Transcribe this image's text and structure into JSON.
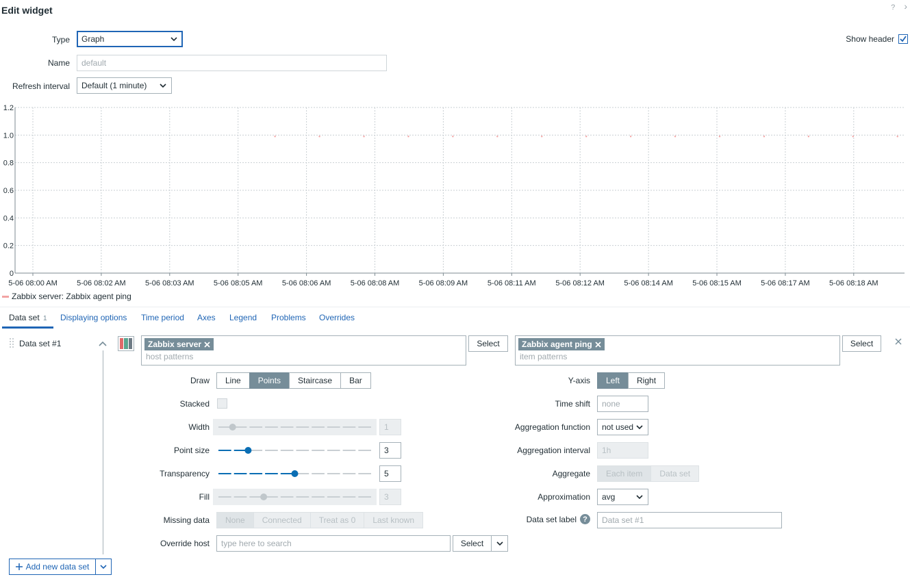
{
  "header": {
    "title": "Edit widget",
    "help_icon": "?",
    "collapse_icon": "›"
  },
  "form": {
    "type_label": "Type",
    "type_value": "Graph",
    "name_label": "Name",
    "name_placeholder": "default",
    "refresh_label": "Refresh interval",
    "refresh_value": "Default (1 minute)",
    "show_header_label": "Show header",
    "show_header_checked": true
  },
  "chart_data": {
    "type": "scatter",
    "y_ticks": [
      "1.2",
      "1.0",
      "0.8",
      "0.6",
      "0.4",
      "0.2",
      "0"
    ],
    "ylim": [
      0,
      1.2
    ],
    "x_ticks": [
      "5-06 08:00 AM",
      "5-06 08:02 AM",
      "5-06 08:03 AM",
      "5-06 08:05 AM",
      "5-06 08:06 AM",
      "5-06 08:08 AM",
      "5-06 08:09 AM",
      "5-06 08:11 AM",
      "5-06 08:12 AM",
      "5-06 08:14 AM",
      "5-06 08:15 AM",
      "5-06 08:17 AM",
      "5-06 08:18 AM"
    ],
    "grid": true,
    "series": [
      {
        "name": "Zabbix server: Zabbix agent ping",
        "color": "#f2a3a3",
        "y": 1,
        "x_index": [
          3.54,
          4.19,
          4.84,
          5.49,
          6.14,
          6.79,
          7.44,
          8.09,
          8.74,
          9.39,
          10.04,
          10.69,
          11.34,
          11.99,
          12.64
        ]
      }
    ],
    "legend": "bottom-left"
  },
  "tabs": [
    {
      "label": "Data set",
      "count": "1"
    },
    {
      "label": "Displaying options"
    },
    {
      "label": "Time period"
    },
    {
      "label": "Axes"
    },
    {
      "label": "Legend"
    },
    {
      "label": "Problems"
    },
    {
      "label": "Overrides"
    }
  ],
  "dataset": {
    "name": "Data set #1",
    "host_tag": "Zabbix server",
    "host_placeholder": "host patterns",
    "item_tag": "Zabbix agent ping",
    "item_placeholder": "item patterns",
    "select_label": "Select",
    "draw_label": "Draw",
    "draw_options": [
      "Line",
      "Points",
      "Staircase",
      "Bar"
    ],
    "stacked_label": "Stacked",
    "width_label": "Width",
    "width_value": "1",
    "width_level": 0.1,
    "point_size_label": "Point size",
    "point_size_value": "3",
    "point_size_level": 0.2,
    "transparency_label": "Transparency",
    "transparency_value": "5",
    "transparency_level": 0.5,
    "fill_label": "Fill",
    "fill_value": "3",
    "fill_level": 0.3,
    "missing_label": "Missing data",
    "missing_options": [
      "None",
      "Connected",
      "Treat as 0",
      "Last known"
    ],
    "override_host_label": "Override host",
    "override_host_placeholder": "type here to search",
    "yaxis_label": "Y-axis",
    "yaxis_options": [
      "Left",
      "Right"
    ],
    "time_shift_label": "Time shift",
    "time_shift_placeholder": "none",
    "agg_func_label": "Aggregation function",
    "agg_func_value": "not used",
    "agg_interval_label": "Aggregation interval",
    "agg_interval_value": "1h",
    "aggregate_label": "Aggregate",
    "aggregate_options": [
      "Each item",
      "Data set"
    ],
    "approx_label": "Approximation",
    "approx_value": "avg",
    "ds_label_label": "Data set label",
    "ds_label_placeholder": "Data set #1",
    "add_new_label": "Add new data set"
  },
  "colors": {
    "accent": "#1f65b5",
    "slider": "#0a6eb4",
    "tag": "#768d99",
    "series": "#f2a3a3"
  }
}
